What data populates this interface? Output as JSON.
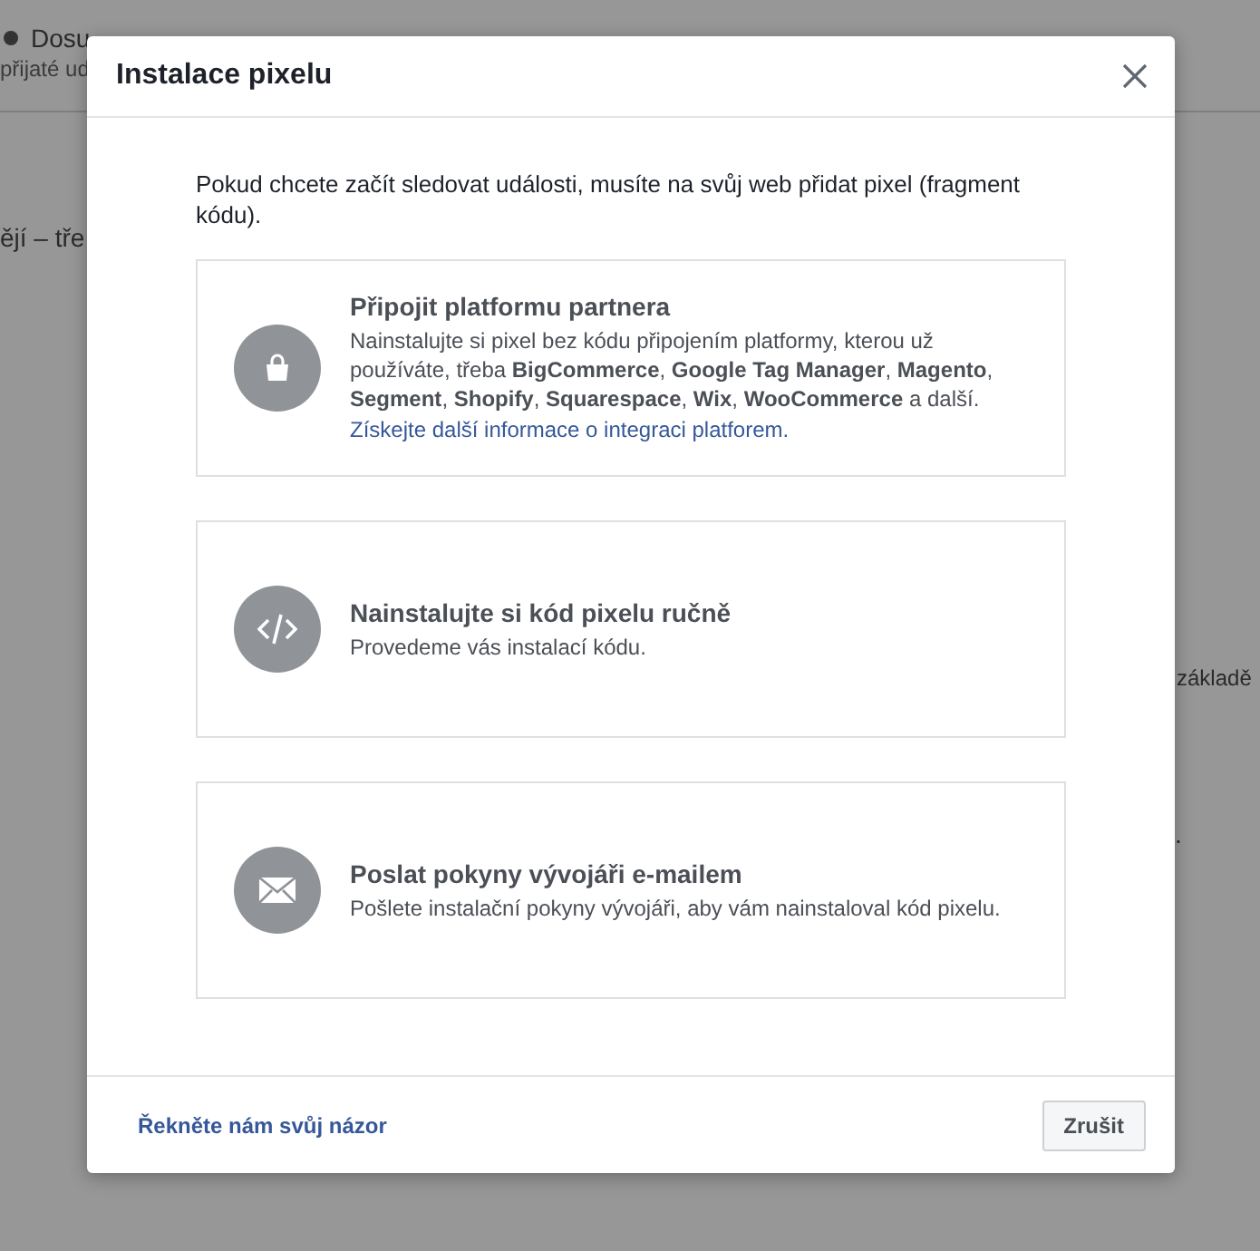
{
  "background": {
    "status_text": "Dosu",
    "subtitle": "přijaté ud",
    "body_text": "ějí – tře",
    "side_text": "základě",
    "side_mark": "."
  },
  "dialog": {
    "title": "Instalace pixelu",
    "intro": "Pokud chcete začít sledovat události, musíte na svůj web přidat pixel (fragment kódu).",
    "options": [
      {
        "kind": "bag",
        "title": "Připojit platformu partnera",
        "description": "Nainstalujte si pixel bez kódu připojením platformy, kterou už používáte, třeba **BigCommerce**, **Google Tag Manager**, **Magento**, **Segment**, **Shopify**, **Squarespace**, **Wix**, **WooCommerce** a další.",
        "link": "Získejte další informace o integraci platforem."
      },
      {
        "kind": "code",
        "title": "Nainstalujte si kód pixelu ručně",
        "description": "Provedeme vás instalací kódu."
      },
      {
        "kind": "mail",
        "title": "Poslat pokyny vývojáři e-mailem",
        "description": "Pošlete instalační pokyny vývojáři, aby vám nainstaloval kód pixelu."
      }
    ],
    "feedback_link": "Řekněte nám svůj názor",
    "cancel_button": "Zrušit"
  }
}
